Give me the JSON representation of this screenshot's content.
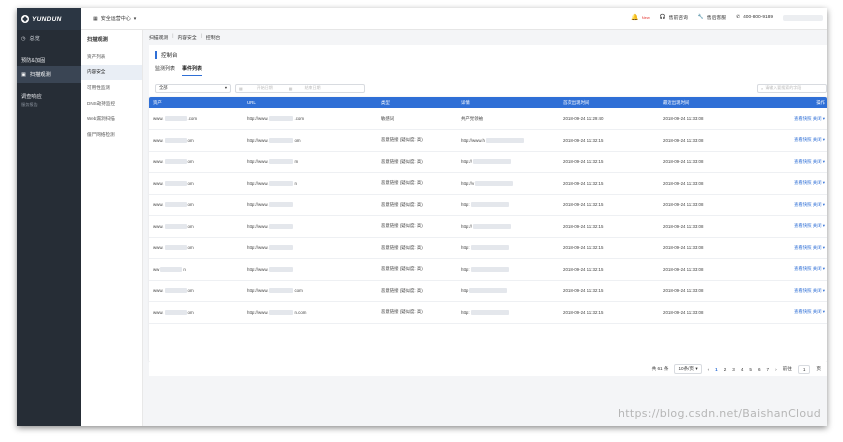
{
  "brand": {
    "name": "YUNDUN"
  },
  "app_switch": {
    "label": "安全运营中心"
  },
  "top_right": {
    "alert": "New",
    "support": "售前咨询",
    "service": "售后客服",
    "phone": "400-800-9189"
  },
  "leftnav": {
    "overview": "总览",
    "group_protect": "预防&加固",
    "scan_monitor": "扫描观测",
    "group_response": "调查响应",
    "response_sub": "服务报告"
  },
  "subnav": {
    "title": "扫描观测",
    "items": [
      "资产列表",
      "内容安全",
      "可用性监测",
      "DNS劫持监控",
      "Web漏洞扫描",
      "僵尸网络检测"
    ]
  },
  "breadcrumb": {
    "items": [
      "扫描观测",
      "内容安全",
      "控制台"
    ]
  },
  "page": {
    "title": "控制台"
  },
  "tabs": [
    "监测列表",
    "事件列表"
  ],
  "filters": {
    "type_value": "全部",
    "date_start_placeholder": "开始日期",
    "date_end_placeholder": "结束日期",
    "search_placeholder": "请输入要搜索的字段"
  },
  "table": {
    "columns": [
      "资产",
      "URL",
      "类型",
      "详情",
      "首次出现时间",
      "最近出现时间",
      "操作"
    ],
    "rows": [
      {
        "asset_prefix": "www.",
        "asset_suffix": ".com",
        "url_prefix": "http://www.",
        "url_suffix": ".com",
        "type": "敏感词",
        "detail": "共产党领袖",
        "first": "2018-09-24 11:29:40",
        "last": "2018-09-24 11:33:08",
        "view": "查看快照",
        "close": "关闭"
      },
      {
        "asset_prefix": "www.",
        "asset_suffix": "om",
        "url_prefix": "http://www.",
        "url_suffix": "om",
        "type": "恶意链接 (疑似度: 高)",
        "detail": "http://www.h",
        "first": "2018-09-24 11:32:15",
        "last": "2018-09-24 11:33:08",
        "view": "查看快照",
        "close": "关闭"
      },
      {
        "asset_prefix": "www.",
        "asset_suffix": "om",
        "url_prefix": "http://www.",
        "url_suffix": "m",
        "type": "恶意链接 (疑似度: 高)",
        "detail": "http://",
        "first": "2018-09-24 11:32:15",
        "last": "2018-09-24 11:33:08",
        "view": "查看快照",
        "close": "关闭"
      },
      {
        "asset_prefix": "www.",
        "asset_suffix": "om",
        "url_prefix": "http://www.",
        "url_suffix": "n",
        "type": "恶意链接 (疑似度: 高)",
        "detail": "http://v",
        "first": "2018-09-24 11:32:15",
        "last": "2018-09-24 11:33:08",
        "view": "查看快照",
        "close": "关闭"
      },
      {
        "asset_prefix": "www.",
        "asset_suffix": "om",
        "url_prefix": "http://www.",
        "url_suffix": "",
        "type": "恶意链接 (疑似度: 高)",
        "detail": "http:",
        "first": "2018-09-24 11:32:15",
        "last": "2018-09-24 11:33:08",
        "view": "查看快照",
        "close": "关闭"
      },
      {
        "asset_prefix": "www.",
        "asset_suffix": "om",
        "url_prefix": "http://www.",
        "url_suffix": "",
        "type": "恶意链接 (疑似度: 高)",
        "detail": "http://",
        "first": "2018-09-24 11:32:15",
        "last": "2018-09-24 11:33:08",
        "view": "查看快照",
        "close": "关闭"
      },
      {
        "asset_prefix": "www.",
        "asset_suffix": "om",
        "url_prefix": "http://www.",
        "url_suffix": "",
        "type": "恶意链接 (疑似度: 高)",
        "detail": "http:",
        "first": "2018-09-24 11:32:15",
        "last": "2018-09-24 11:33:08",
        "view": "查看快照",
        "close": "关闭"
      },
      {
        "asset_prefix": "ww",
        "asset_suffix": "n",
        "url_prefix": "http://www.",
        "url_suffix": "",
        "type": "恶意链接 (疑似度: 高)",
        "detail": "http:",
        "first": "2018-09-24 11:32:15",
        "last": "2018-09-24 11:33:08",
        "view": "查看快照",
        "close": "关闭"
      },
      {
        "asset_prefix": "www.",
        "asset_suffix": "om",
        "url_prefix": "http://www.",
        "url_suffix": "com",
        "type": "恶意链接 (疑似度: 高)",
        "detail": "http",
        "first": "2018-09-24 11:32:15",
        "last": "2018-09-24 11:33:08",
        "view": "查看快照",
        "close": "关闭"
      },
      {
        "asset_prefix": "www.",
        "asset_suffix": "om",
        "url_prefix": "http://www.",
        "url_suffix": "n.com",
        "type": "恶意链接 (疑似度: 高)",
        "detail": "http:",
        "first": "2018-09-24 11:32:15",
        "last": "2018-09-24 11:33:08",
        "view": "查看快照",
        "close": "关闭"
      }
    ]
  },
  "pagination": {
    "total": "共 61 条",
    "page_size": "10条/页",
    "pages": [
      "1",
      "2",
      "3",
      "4",
      "5",
      "6",
      "7"
    ],
    "goto_label": "前往",
    "goto_value": "1",
    "page_unit": "页"
  },
  "watermark": "https://blog.csdn.net/BaishanCloud",
  "colors": {
    "accent": "#2f6fd6",
    "sidebar": "#262d36",
    "alert": "#e53935"
  }
}
